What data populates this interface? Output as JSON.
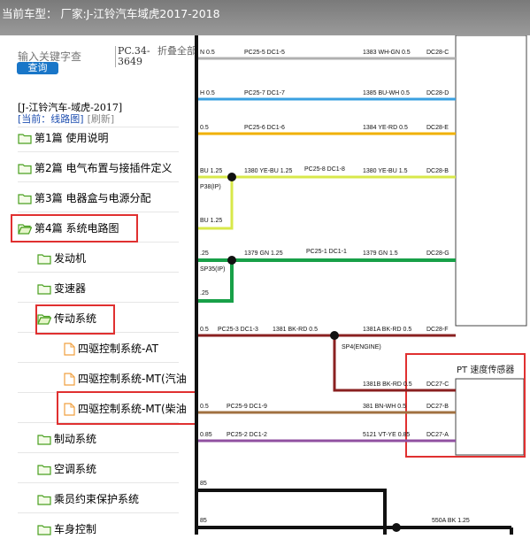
{
  "header": {
    "title": "当前车型：  厂家:J-江铃汽车域虎2017-2018"
  },
  "search": {
    "placeholder": "输入关键字查",
    "button_label": "查询",
    "code": "PC.34-3649",
    "fold_all": "折叠全部"
  },
  "breadcrumb": {
    "model": "[J-江铃汽车-域虎-2017]",
    "current": "[当前：线路图]",
    "refresh": "[刷新]"
  },
  "tree": {
    "items": [
      {
        "label": "第1篇 使用说明",
        "icon": "folder-icon"
      },
      {
        "label": "第2篇 电气布置与接插件定义",
        "icon": "folder-icon"
      },
      {
        "label": "第3篇 电器盒与电源分配",
        "icon": "folder-icon"
      },
      {
        "label": "第4篇 系统电路图",
        "icon": "folder-open-icon"
      },
      {
        "label": "发动机",
        "icon": "folder-icon"
      },
      {
        "label": "变速器",
        "icon": "folder-icon"
      },
      {
        "label": "传动系统",
        "icon": "folder-open-icon"
      },
      {
        "label": "四驱控制系统-AT",
        "icon": "file-icon"
      },
      {
        "label": "四驱控制系统-MT(汽油",
        "icon": "file-icon"
      },
      {
        "label": "四驱控制系统-MT(柴油",
        "icon": "file-icon"
      },
      {
        "label": "制动系统",
        "icon": "folder-icon"
      },
      {
        "label": "空调系统",
        "icon": "folder-icon"
      },
      {
        "label": "乘员约束保护系统",
        "icon": "folder-icon"
      },
      {
        "label": "车身控制",
        "icon": "folder-icon"
      }
    ]
  },
  "diagram": {
    "wires": [
      {
        "left": "N 0.5",
        "conn": "PC25-5 DC1-5",
        "right": "1383 WH-GN 0.5",
        "end": "DC28-C",
        "color": "#b0b0b0"
      },
      {
        "left": "H 0.5",
        "conn": "PC25-7 DC1-7",
        "right": "1385 BU-WH 0.5",
        "end": "DC28-D",
        "color": "#3aa0e0"
      },
      {
        "left": "0.5",
        "conn": "PC25-6 DC1-6",
        "right": "1384 YE-RD 0.5",
        "end": "DC28-E",
        "color": "#f0b000"
      },
      {
        "left": "BU 1.25",
        "mid": "1380 YE-BU 1.25",
        "conn": "PC25-8 DC1-8",
        "right": "1380 YE-BU 1.5",
        "end": "DC28-B",
        "color": "#d8e84a"
      },
      {
        "left": ".25",
        "mid": "1379 GN 1.25",
        "conn": "PC25-1 DC1-1",
        "right": "1379 GN 1.5",
        "end": "DC28-G",
        "color": "#18a048"
      },
      {
        "left": "0.5",
        "mid": "1381 BK-RD 0.5",
        "conn": "PC25-3 DC1-3",
        "right": "1381A BK-RD 0.5",
        "end": "DC28-F",
        "color": "#8a2020"
      },
      {
        "right": "1381B BK-RD 0.5",
        "end": "DC27-C",
        "color": "#8a2020"
      },
      {
        "left": "0.5",
        "conn": "PC25-9 DC1-9",
        "right": "381 BN-WH 0.5",
        "end": "DC27-B",
        "color": "#a07040"
      },
      {
        "left": "0.85",
        "conn": "PC25-2 DC1-2",
        "right": "5121 VT-YE 0.85",
        "end": "DC27-A",
        "color": "#9050a0"
      },
      {
        "right": "550A BK 1.25",
        "color": "#111"
      }
    ],
    "side_labels": [
      "P38(IP)",
      "BU 1.25",
      "SP35(IP)",
      ".25",
      "SP4(ENGINE)",
      "85",
      "85"
    ],
    "sensor": {
      "code": "PT",
      "name": "速度传感器"
    }
  }
}
